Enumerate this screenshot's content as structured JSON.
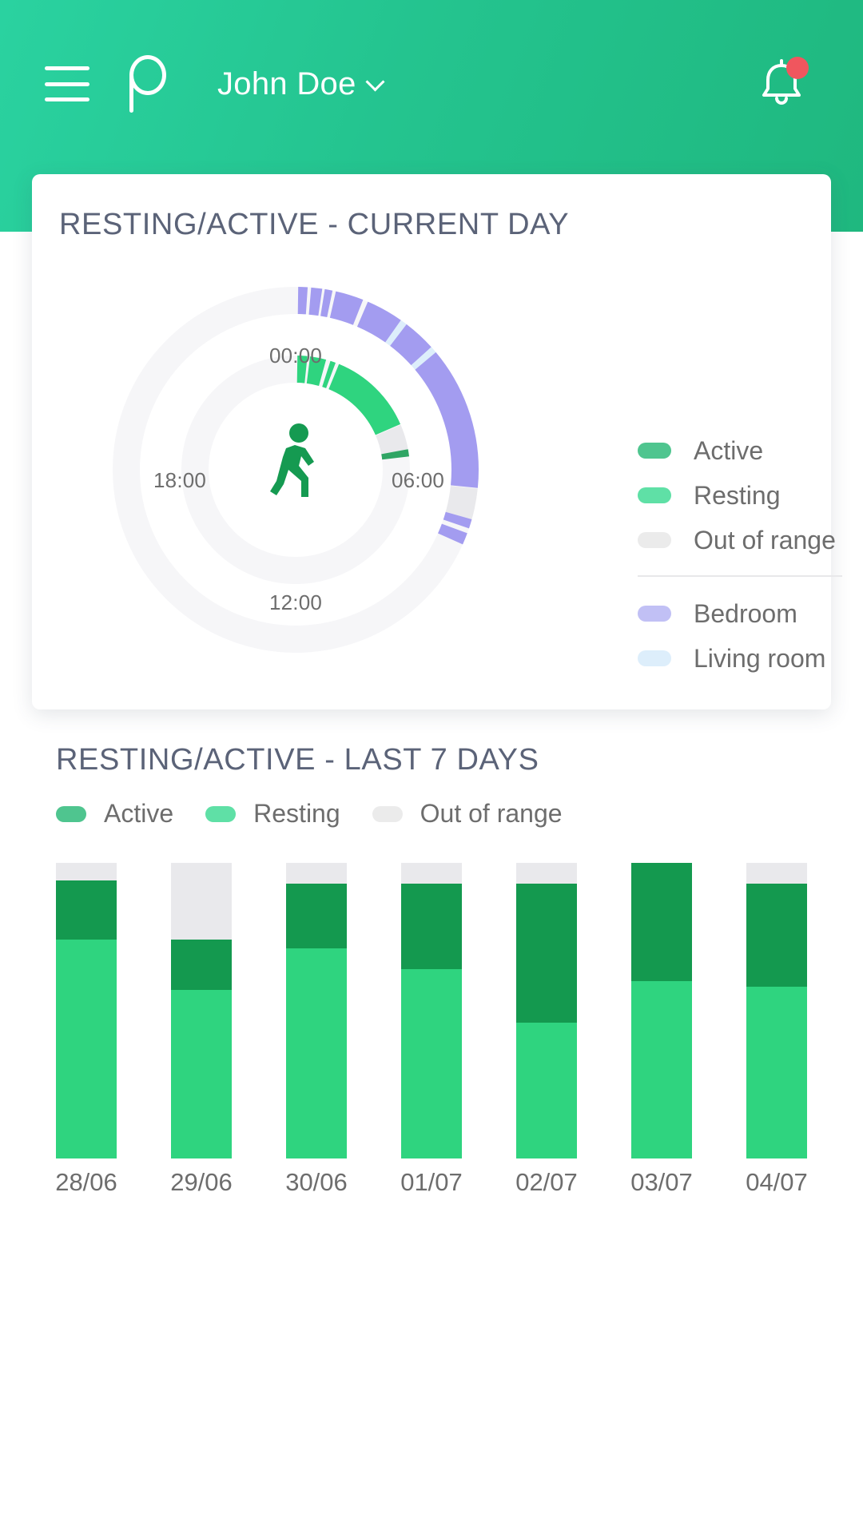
{
  "header": {
    "menu_icon": "hamburger-icon",
    "logo_icon": "brand-p-logo",
    "user_name": "John Doe",
    "caret_icon": "chevron-down-icon",
    "bell_icon": "notification-bell-icon",
    "has_unread": true,
    "gradient_from": "#2ad2a0",
    "gradient_to": "#1fb87f"
  },
  "card": {
    "title": "RESTING/ACTIVE - CURRENT DAY",
    "center_icon": "walking-person-icon",
    "legend": [
      {
        "label": "Active",
        "color": "#4fc58f"
      },
      {
        "label": "Resting",
        "color": "#5fe0a6"
      },
      {
        "label": "Out of range",
        "color": "#ebebeb"
      },
      {
        "label": "Bedroom",
        "color": "#c1c0f5"
      },
      {
        "label": "Living room",
        "color": "#ddeefb"
      }
    ],
    "divider_after_index": 2
  },
  "chart_data": [
    {
      "type": "pie",
      "title": "RESTING/ACTIVE - CURRENT DAY",
      "subtype": "radial-timeline-24h",
      "tick_labels": [
        "00:00",
        "06:00",
        "12:00",
        "18:00"
      ],
      "rings": [
        {
          "name": "Location (outer ring)",
          "radius_px": 212,
          "track_color": "#f5f5f7",
          "segments": [
            {
              "series": "Bedroom",
              "color": "#a39cf0",
              "start_hour": 0.05,
              "end_hour": 0.25
            },
            {
              "series": "Bedroom",
              "color": "#a39cf0",
              "start_hour": 0.32,
              "end_hour": 0.55
            },
            {
              "series": "Bedroom",
              "color": "#a39cf0",
              "start_hour": 0.62,
              "end_hour": 0.78
            },
            {
              "series": "Bedroom",
              "color": "#a39cf0",
              "start_hour": 0.85,
              "end_hour": 1.45
            },
            {
              "series": "Bedroom",
              "color": "#a39cf0",
              "start_hour": 1.55,
              "end_hour": 2.35
            },
            {
              "series": "Living room",
              "color": "#ddeefb",
              "start_hour": 2.35,
              "end_hour": 2.5
            },
            {
              "series": "Bedroom",
              "color": "#a39cf0",
              "start_hour": 2.5,
              "end_hour": 3.2
            },
            {
              "series": "Living room",
              "color": "#ddeefb",
              "start_hour": 3.2,
              "end_hour": 3.35
            },
            {
              "series": "Bedroom",
              "color": "#a39cf0",
              "start_hour": 3.35,
              "end_hour": 6.4
            },
            {
              "series": "Out of range",
              "color": "#e9e9ec",
              "start_hour": 6.4,
              "end_hour": 7.05
            },
            {
              "series": "Bedroom",
              "color": "#a39cf0",
              "start_hour": 7.05,
              "end_hour": 7.25
            },
            {
              "series": "Bedroom",
              "color": "#a39cf0",
              "start_hour": 7.35,
              "end_hour": 7.6
            },
            {
              "series": "Out of range",
              "color": "#f5f5f7",
              "start_hour": 7.6,
              "end_hour": 24
            }
          ]
        },
        {
          "name": "Activity (inner ring)",
          "radius_px": 126,
          "track_color": "#f5f5f7",
          "segments": [
            {
              "series": "Resting",
              "color": "#2fd47f",
              "start_hour": 0.05,
              "end_hour": 0.4
            },
            {
              "series": "Resting",
              "color": "#2fd47f",
              "start_hour": 0.5,
              "end_hour": 1.05
            },
            {
              "series": "Resting",
              "color": "#2fd47f",
              "start_hour": 1.2,
              "end_hour": 1.4
            },
            {
              "series": "Resting",
              "color": "#2fd47f",
              "start_hour": 1.5,
              "end_hour": 4.45
            },
            {
              "series": "Out of range",
              "color": "#e9e9ec",
              "start_hour": 4.45,
              "end_hour": 5.3
            },
            {
              "series": "Active",
              "color": "#2fa564",
              "start_hour": 5.3,
              "end_hour": 5.55
            },
            {
              "series": "Out of range",
              "color": "#f5f5f7",
              "start_hour": 5.55,
              "end_hour": 24
            }
          ]
        }
      ],
      "legend_position": "right",
      "grid": false
    },
    {
      "type": "bar",
      "subtype": "stacked",
      "title": "RESTING/ACTIVE - LAST 7 DAYS",
      "categories": [
        "28/06",
        "29/06",
        "30/06",
        "01/07",
        "02/07",
        "03/07",
        "04/07"
      ],
      "series": [
        {
          "name": "Resting",
          "color": "#2fd47f",
          "values": [
            74,
            57,
            71,
            64,
            46,
            60,
            58
          ]
        },
        {
          "name": "Active",
          "color": "#14994f",
          "values": [
            20,
            17,
            22,
            29,
            47,
            40,
            35
          ]
        },
        {
          "name": "Out of range",
          "color": "#e9e9ec",
          "values": [
            6,
            26,
            7,
            7,
            7,
            0,
            7
          ]
        }
      ],
      "xlabel": "",
      "ylabel": "",
      "ylim": [
        0,
        100
      ],
      "stack_total": 100,
      "legend_position": "top",
      "grid": false
    }
  ],
  "bars_section": {
    "title": "RESTING/ACTIVE - LAST 7 DAYS",
    "legend": [
      {
        "label": "Active",
        "color": "#4fc58f"
      },
      {
        "label": "Resting",
        "color": "#5fe0a6"
      },
      {
        "label": "Out of range",
        "color": "#ebebeb"
      }
    ]
  }
}
